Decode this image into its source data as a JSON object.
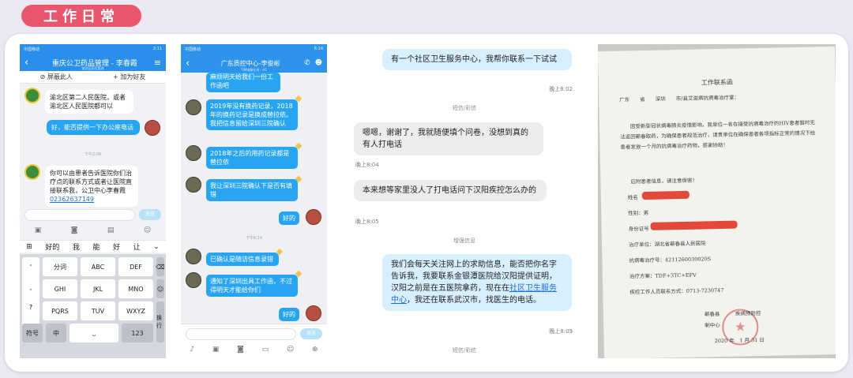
{
  "header": {
    "title": "工作日常"
  },
  "phone1": {
    "statusbar": {
      "left": "中国移动",
      "right": "2:11"
    },
    "nav": {
      "back_icon": "‹",
      "title": "重庆公卫药品管理 - 李春霞",
      "subtitle": "渝北区药品管理",
      "menu_icon": "≡"
    },
    "actions": {
      "block": "屏蔽此人",
      "add_friend": "加为好友"
    },
    "messages": [
      {
        "side": "left",
        "text": "渝北区第二人民医院，或者渝北区人民医院都可以"
      },
      {
        "side": "right",
        "text": "好，能否提供一下办公座电话"
      },
      {
        "side": "left",
        "text": "你可以由患者告诉医院你们治疗点的联系方式或者让医院直接联系我，公卫中心李春霞",
        "link": "02362637149"
      }
    ],
    "time": "下午2:08",
    "send_label": "发送",
    "suggestions": [
      "好的",
      "我",
      "能",
      "好",
      "让"
    ],
    "keyboard": {
      "punct": [
        "'",
        ",",
        "?",
        "!"
      ],
      "rows": [
        [
          "分词",
          "ABC",
          "DEF"
        ],
        [
          "GHI",
          "JKL",
          "MNO"
        ],
        [
          "PQRS",
          "TUV",
          "WXYZ"
        ]
      ],
      "bottom": [
        "符号",
        "中",
        "123"
      ],
      "enter": "换行"
    }
  },
  "phone2": {
    "statusbar": {
      "left": "中国移动",
      "right": "6:14"
    },
    "nav": {
      "back_icon": "‹",
      "title": "广东质控中心-李俊彬",
      "subtitle": "TIM电脑在线 - 4G"
    },
    "top_fragment": "麻烦明天给我们一份工作函吧",
    "messages": [
      {
        "side": "left",
        "text": "2019年没有换药记录，2018年的换药记录是换成替拉依。我把信息留给深圳三院确认"
      },
      {
        "side": "left",
        "text": "2018年之后的用药记录都是替拉依"
      },
      {
        "side": "left",
        "text": "我让深圳三院确认下是否有填错"
      },
      {
        "side": "right",
        "text": "好的"
      },
      {
        "side": "left",
        "text": "已确认是随访信息录错"
      },
      {
        "side": "left",
        "text": "通知了深圳出具工作函，不过得明天才能给你们"
      },
      {
        "side": "right",
        "text": "好的"
      }
    ],
    "time": "下午6:14",
    "send_label": "发送"
  },
  "sms": {
    "messages": [
      {
        "dir": "out",
        "text": "有一个社区卫生服务中心，我帮你联系一下试试",
        "time": "晚上8:02"
      },
      {
        "dir": "in",
        "text": "嗯嗯，谢谢了，我就随便填个问卷，没想到真的有人打电话",
        "time": "晚上8:04"
      },
      {
        "dir": "in",
        "text": "本来想等家里没人了打电话问下汉阳疾控怎么办的",
        "time": "晚上8:05"
      },
      {
        "dir": "out",
        "text_before": "我们会每天关注网上的求助信息，能否把你名字告诉我，我要联系金银潭医院给汉阳提供证明，汉阳之前是在五医院拿药，现在在",
        "link": "社区卫生服务中心",
        "text_after": "，我还在联系武汉市，找医生的电话。",
        "time": "晚上8:09"
      }
    ],
    "labels": {
      "sms": "短信/彩信",
      "enhanced": "增强信息"
    }
  },
  "letter": {
    "title": "工作联系函",
    "line1": "广东　　省　　深圳　　市/县艾滋病抗病毒治疗室：",
    "body": "因受新型冠状病毒肺炎疫情影响，我单位一名在接受抗病毒治疗的HIV患者暂时无法返回蕲春取药，为确保患者规范治疗，请贵单位在确保患者各项指标正常的情况下给患者发放一个月的抗病毒治疗药物，感谢协助！",
    "info_heading": "后附患者信息，请注意保密！",
    "fields": [
      {
        "label": "姓名",
        "value": ""
      },
      {
        "label": "性别",
        "value": "男"
      },
      {
        "label": "身份证号",
        "value": ""
      },
      {
        "label": "治疗单位",
        "value": "湖北省蕲春县人民医院"
      },
      {
        "label": "抗病毒治疗号",
        "value": "4211260030020S"
      },
      {
        "label": "治疗方案",
        "value": "TDF+3TC+EFV"
      },
      {
        "label": "疾控工作人员联系方式",
        "value": "0713-7230747"
      }
    ],
    "sign1": "蕲春县　　　疾病预防控",
    "sign2": "制中心",
    "date": "2020 年　1 月 31 日"
  }
}
